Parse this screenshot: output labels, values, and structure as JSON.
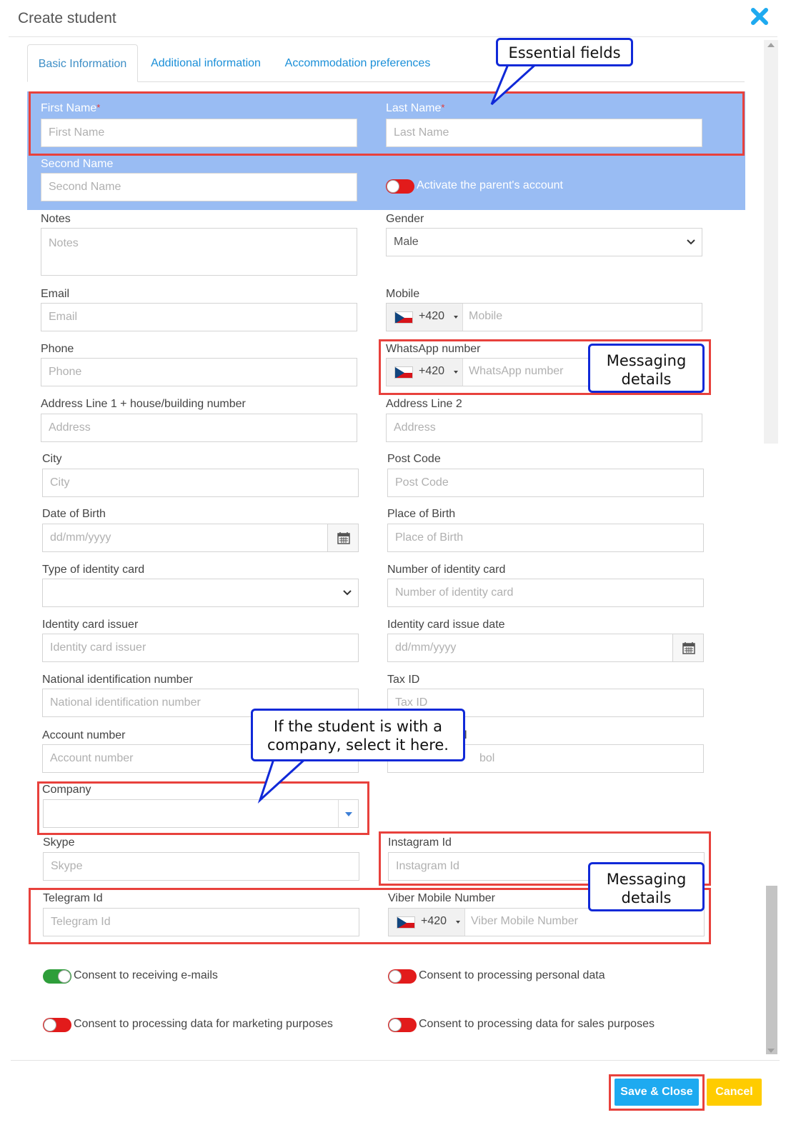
{
  "dialog": {
    "title": "Create student",
    "close_icon": "close-icon"
  },
  "tabs": [
    {
      "label": "Basic Information"
    },
    {
      "label": "Additional information"
    },
    {
      "label": "Accommodation preferences"
    }
  ],
  "fields": {
    "first_name": {
      "label": "First Name",
      "placeholder": "First Name",
      "required_mark": "*"
    },
    "last_name": {
      "label": "Last Name",
      "placeholder": "Last Name",
      "required_mark": "*"
    },
    "second_name": {
      "label": "Second Name",
      "placeholder": "Second Name"
    },
    "parent_account": {
      "label": "Activate the parent's account",
      "on": false
    },
    "notes": {
      "label": "Notes",
      "placeholder": "Notes"
    },
    "gender": {
      "label": "Gender",
      "value": "Male"
    },
    "email": {
      "label": "Email",
      "placeholder": "Email"
    },
    "mobile": {
      "label": "Mobile",
      "dial_code": "+420",
      "placeholder": "Mobile"
    },
    "phone": {
      "label": "Phone",
      "placeholder": "Phone"
    },
    "whatsapp": {
      "label": "WhatsApp number",
      "dial_code": "+420",
      "placeholder": "WhatsApp number"
    },
    "address1": {
      "label": "Address Line 1 + house/building number",
      "placeholder": "Address"
    },
    "address2": {
      "label": "Address Line 2",
      "placeholder": "Address"
    },
    "city": {
      "label": "City",
      "placeholder": "City"
    },
    "post_code": {
      "label": "Post Code",
      "placeholder": "Post Code"
    },
    "dob": {
      "label": "Date of Birth",
      "placeholder": "dd/mm/yyyy"
    },
    "place_of_birth": {
      "label": "Place of Birth",
      "placeholder": "Place of Birth"
    },
    "id_type": {
      "label": "Type of identity card",
      "value": ""
    },
    "id_number": {
      "label": "Number of identity card",
      "placeholder": "Number of identity card"
    },
    "id_issuer": {
      "label": "Identity card issuer",
      "placeholder": "Identity card issuer"
    },
    "id_issue_date": {
      "label": "Identity card issue date",
      "placeholder": "dd/mm/yyyy"
    },
    "national_id": {
      "label": "National identification number",
      "placeholder": "National identification number"
    },
    "tax_id": {
      "label": "Tax ID",
      "placeholder": "Tax ID"
    },
    "account_number": {
      "label": "Account number",
      "placeholder": "Account number"
    },
    "account_symbol_label_fragment": "l",
    "account_symbol_placeholder_fragment": "bol",
    "company": {
      "label": "Company",
      "value": ""
    },
    "skype": {
      "label": "Skype",
      "placeholder": "Skype"
    },
    "instagram": {
      "label": "Instagram Id",
      "placeholder": "Instagram Id"
    },
    "telegram": {
      "label": "Telegram Id",
      "placeholder": "Telegram Id"
    },
    "viber": {
      "label": "Viber Mobile Number",
      "dial_code": "+420",
      "placeholder": "Viber Mobile Number"
    }
  },
  "consents": [
    {
      "label": "Consent to receiving e-mails",
      "on": true
    },
    {
      "label": "Consent to processing personal data",
      "on": false
    },
    {
      "label": "Consent to processing data for marketing purposes",
      "on": false
    },
    {
      "label": "Consent to processing data for sales purposes",
      "on": false
    }
  ],
  "buttons": {
    "save": "Save & Close",
    "cancel": "Cancel"
  },
  "annotations": {
    "essential": "Essential fields",
    "messaging": "Messaging details",
    "company_line1": "If the student is with a",
    "company_line2": "company, select it here."
  },
  "colors": {
    "accent": "#1eaaf0",
    "band": "#99bcf3",
    "annotation_red": "#e8413c",
    "annotation_blue": "#1029d8",
    "toggle_on": "#2e9e3a",
    "toggle_off": "#e21b1b",
    "cancel": "#ffcc00"
  }
}
